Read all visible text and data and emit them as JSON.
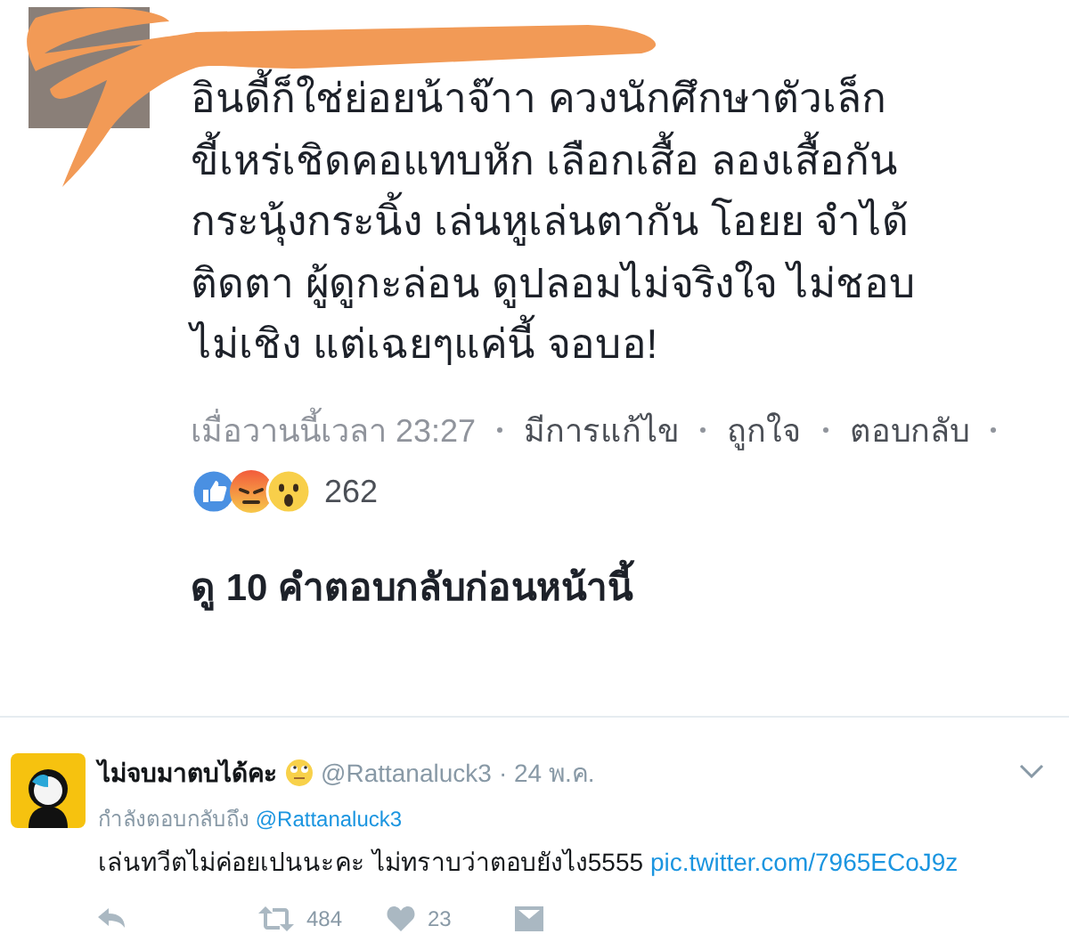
{
  "comment": {
    "lines": [
      "อินดี้ก็ใช่ย่อยน้าจ๊าา  ควงนักศึกษาตัวเล็ก",
      "ขี้เหร่เชิดคอแทบหัก เลือกเสื้อ ลองเสื้อกัน",
      "กระนุ้งกระนิ้ง เล่นหูเล่นตากัน โอยย จำได้",
      "ติดตา ผู้ดูกะล่อน ดูปลอมไม่จริงใจ ไม่ชอบ",
      "ไม่เชิง แต่เฉยๆแค่นี้ จอบอ!"
    ],
    "time": "เมื่อวานนี้เวลา 23:27",
    "actions": [
      "มีการแก้ไข",
      "ถูกใจ",
      "ตอบกลับ"
    ],
    "reactions": [
      {
        "kind": "like"
      },
      {
        "kind": "angry"
      },
      {
        "kind": "wow"
      }
    ],
    "reaction_count": "262"
  },
  "more_replies": "ดู 10 คำตอบกลับก่อนหน้านี้",
  "tweet": {
    "name": "ไม่จบมาตบได้คะ",
    "handle": "@Rattanaluck3",
    "date": "· 24 พ.ค.",
    "replying_to": "กำลังตอบกลับถึง",
    "reply_handle": "@Rattanaluck3",
    "text": "เล่นทวีตไม่ค่อยเปนนะคะ ไม่ทราบว่าตอบยังไง5555",
    "link": "pic.twitter.com/7965ECoJ9z",
    "actions": [
      {
        "kind": "reply"
      },
      {
        "kind": "retweet",
        "count": "484"
      },
      {
        "kind": "like",
        "count": "23"
      },
      {
        "kind": "message"
      }
    ]
  }
}
